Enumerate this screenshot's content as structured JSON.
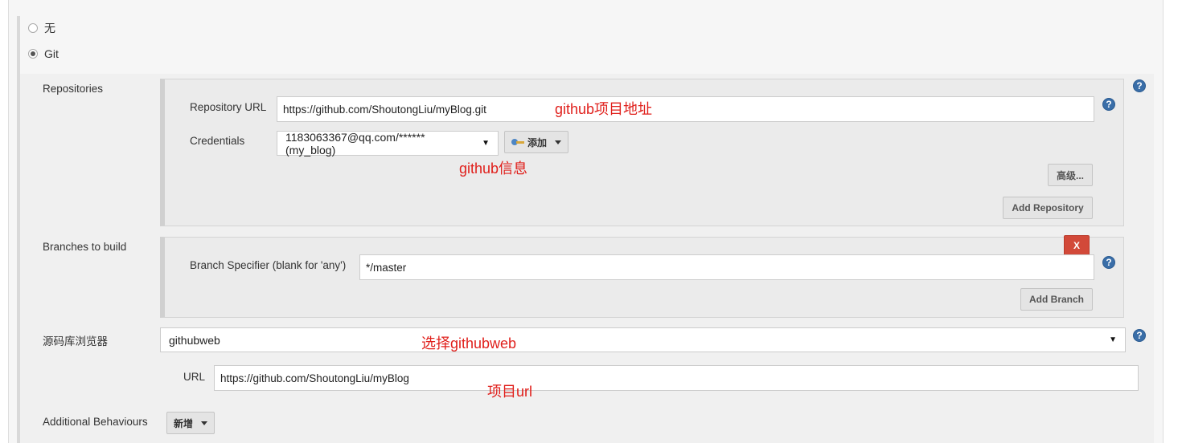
{
  "scm": {
    "options": [
      {
        "label": "无",
        "selected": false
      },
      {
        "label": "Git",
        "selected": true
      }
    ]
  },
  "repositories": {
    "label": "Repositories",
    "url_label": "Repository URL",
    "url_value": "https://github.com/ShoutongLiu/myBlog.git",
    "credentials_label": "Credentials",
    "credentials_value": "1183063367@qq.com/****** (my_blog)",
    "add_credentials_label": "添加",
    "advanced_label": "高级...",
    "add_repository_label": "Add Repository"
  },
  "branches": {
    "label": "Branches to build",
    "delete_label": "X",
    "specifier_label": "Branch Specifier (blank for 'any')",
    "specifier_value": "*/master",
    "add_branch_label": "Add Branch"
  },
  "browser": {
    "label": "源码库浏览器",
    "value": "githubweb",
    "url_label": "URL",
    "url_value": "https://github.com/ShoutongLiu/myBlog"
  },
  "behaviours": {
    "label": "Additional Behaviours",
    "add_label": "新增"
  },
  "annotations": {
    "repo_url": "github项目地址",
    "credentials": "github信息",
    "browser": "选择githubweb",
    "url": "项目url"
  },
  "colors": {
    "annotation": "#e0201c",
    "help_icon": "#3a6ea8",
    "delete_button": "#d24939"
  },
  "icons": {
    "help": "question-circle-icon",
    "key": "key-icon",
    "dropdown": "caret-down-icon"
  }
}
